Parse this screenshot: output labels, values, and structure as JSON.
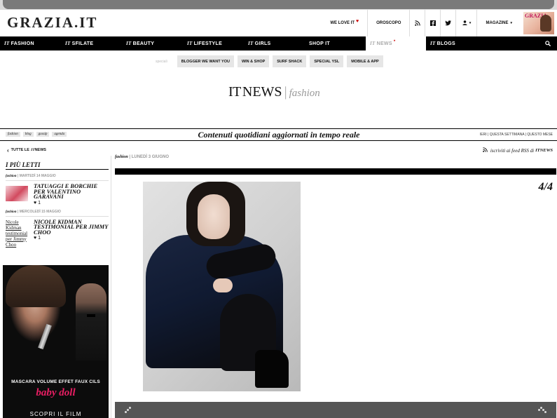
{
  "site": {
    "logo": "GRAZIA.IT"
  },
  "topbar": {
    "we_love_it": "WE LOVE IT",
    "heart": "♥",
    "oroscopo": "OROSCOPO",
    "magazine": "MAGAZINE",
    "magazine_cover_title": "GRAZIA",
    "icons": [
      "rss-icon",
      "facebook-icon",
      "twitter-icon",
      "user-icon",
      "chevron-down-icon"
    ]
  },
  "nav": {
    "items": [
      {
        "it": "IT",
        "label": "FASHION"
      },
      {
        "it": "IT",
        "label": "SFILATE"
      },
      {
        "it": "IT",
        "label": "BEAUTY"
      },
      {
        "it": "IT",
        "label": "LIFESTYLE"
      },
      {
        "it": "IT",
        "label": "GIRLS"
      },
      {
        "it": "",
        "label": "SHOP IT"
      },
      {
        "it": "IT",
        "label": "NEWS"
      },
      {
        "it": "IT",
        "label": "BLOGS"
      }
    ],
    "active_index": 6,
    "active_mark": "*"
  },
  "specials": {
    "label": "speciali",
    "items": [
      "BLOGGER WE WANT YOU",
      "WIN & SHOP",
      "SURF SHACK",
      "SPECIAL YSL",
      "MOBILE & APP"
    ]
  },
  "section": {
    "it": "IT",
    "news": "NEWS",
    "separator": "|",
    "category": "fashion"
  },
  "filterbar": {
    "tags": [
      "fashion",
      "blog",
      "gossip",
      "agenda"
    ],
    "tagline": "Contenuti quotidiani aggiornati in tempo reale",
    "periods": "IERI | QUESTA SETTIMANA | QUESTO MESE"
  },
  "sidebar": {
    "back_label": "TUTTE LE",
    "back_it": "IT",
    "back_news": "NEWS",
    "popular_title": "I PIÙ LETTI",
    "items": [
      {
        "category": "fashion",
        "date": "MARTEDÌ 14 MAGGIO",
        "title": "TATUAGGI E BORCHIE PER VALENTINO GARAVANI",
        "likes": "♥ 1",
        "alt": ""
      },
      {
        "category": "fashion",
        "date": "MERCOLEDÌ 15 MAGGIO",
        "title": "NICOLE KIDMAN TESTIMONIAL PER JIMMY CHOO",
        "likes": "♥ 1",
        "alt": "Nicole Kidman testimonial per Jimmy Choo"
      }
    ]
  },
  "ad": {
    "caption": "MASCARA VOLUME EFFET FAUX CILS",
    "script": "baby doll",
    "cta": "SCOPRI IL FILM"
  },
  "article": {
    "category": "fashion",
    "date": "LUNEDÌ 3 GIUGNO",
    "rss_label": "iscriviti ai feed RSS di",
    "rss_it": "IT",
    "rss_news": "NEWS",
    "counter": "4/4"
  }
}
